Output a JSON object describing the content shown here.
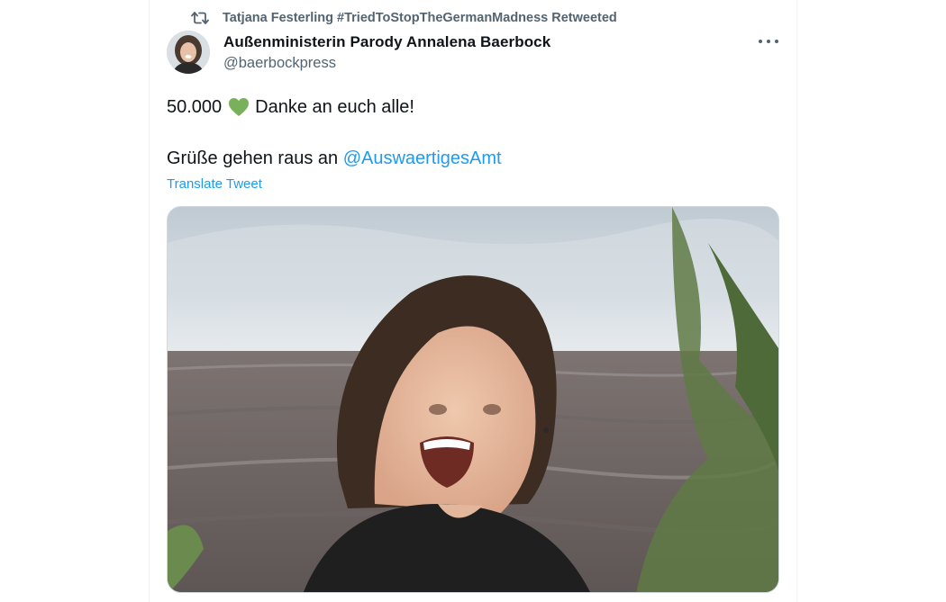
{
  "retweet": {
    "icon": "retweet-icon",
    "text": "Tatjana Festerling #TriedToStopTheGermanMadness Retweeted"
  },
  "author": {
    "name": "Außenministerin Parody Annalena Baerbock",
    "handle": "@baerbockpress",
    "avatar_icon": "avatar"
  },
  "menu": {
    "icon": "more-options-icon"
  },
  "tweet": {
    "count_text": "50.000",
    "emoji": "green-heart-icon",
    "thanks_text": "Danke an euch alle!",
    "greeting_text": "Grüße gehen raus an ",
    "mention": "@AuswaertigesAmt",
    "translate_label": "Translate Tweet"
  },
  "colors": {
    "link": "#1d9bf0",
    "secondary_text": "#536471",
    "heart": "#78b159"
  }
}
